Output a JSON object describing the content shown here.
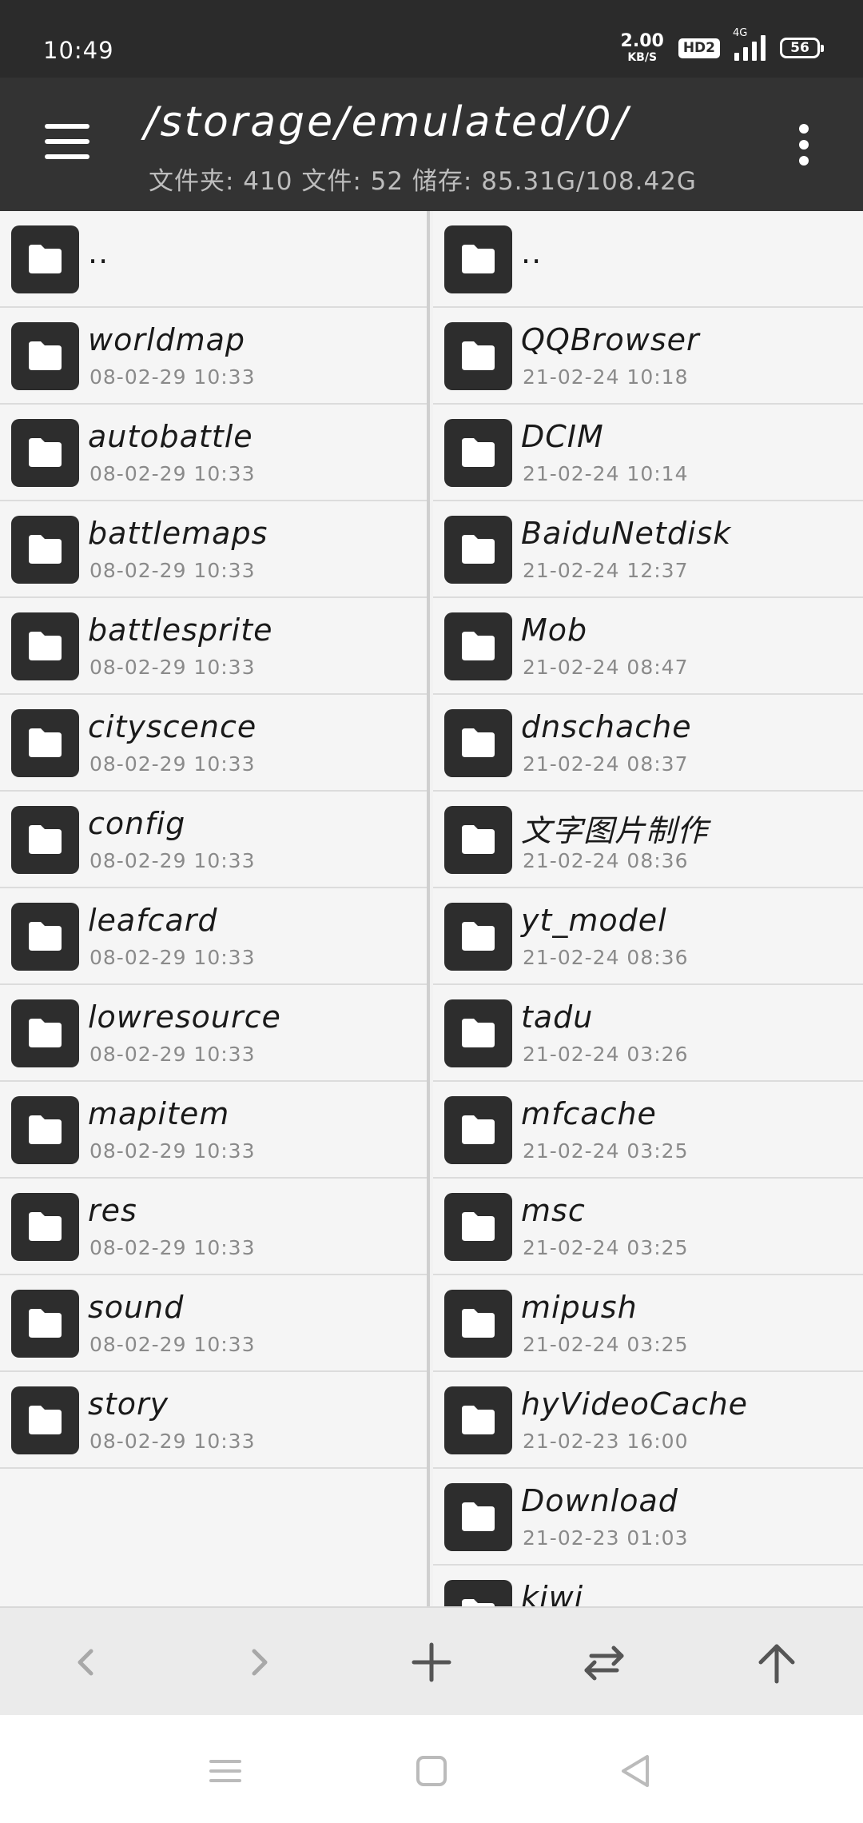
{
  "status_bar": {
    "time": "10:49",
    "net_speed_value": "2.00",
    "net_speed_unit": "KB/S",
    "hd_badge": "HD2",
    "network_type": "4G",
    "battery_level": "56"
  },
  "app_bar": {
    "path": "/storage/emulated/0/",
    "summary": "文件夹: 410  文件: 52  储存: 85.31G/108.42G",
    "menu_icon": "hamburger-menu-icon",
    "more_icon": "vertical-dots-icon"
  },
  "left_pane": {
    "items": [
      {
        "name": "..",
        "date": ""
      },
      {
        "name": "worldmap",
        "date": "08-02-29 10:33"
      },
      {
        "name": "autobattle",
        "date": "08-02-29 10:33"
      },
      {
        "name": "battlemaps",
        "date": "08-02-29 10:33"
      },
      {
        "name": "battlesprite",
        "date": "08-02-29 10:33"
      },
      {
        "name": "cityscence",
        "date": "08-02-29 10:33"
      },
      {
        "name": "config",
        "date": "08-02-29 10:33"
      },
      {
        "name": "leafcard",
        "date": "08-02-29 10:33"
      },
      {
        "name": "lowresource",
        "date": "08-02-29 10:33"
      },
      {
        "name": "mapitem",
        "date": "08-02-29 10:33"
      },
      {
        "name": "res",
        "date": "08-02-29 10:33"
      },
      {
        "name": "sound",
        "date": "08-02-29 10:33"
      },
      {
        "name": "story",
        "date": "08-02-29 10:33"
      }
    ]
  },
  "right_pane": {
    "items": [
      {
        "name": "..",
        "date": ""
      },
      {
        "name": "QQBrowser",
        "date": "21-02-24 10:18"
      },
      {
        "name": "DCIM",
        "date": "21-02-24 10:14"
      },
      {
        "name": "BaiduNetdisk",
        "date": "21-02-24 12:37"
      },
      {
        "name": "Mob",
        "date": "21-02-24 08:47"
      },
      {
        "name": "dnschache",
        "date": "21-02-24 08:37"
      },
      {
        "name": "文字图片制作",
        "date": "21-02-24 08:36"
      },
      {
        "name": "yt_model",
        "date": "21-02-24 08:36"
      },
      {
        "name": "tadu",
        "date": "21-02-24 03:26"
      },
      {
        "name": "mfcache",
        "date": "21-02-24 03:25"
      },
      {
        "name": "msc",
        "date": "21-02-24 03:25"
      },
      {
        "name": "mipush",
        "date": "21-02-24 03:25"
      },
      {
        "name": "hyVideoCache",
        "date": "21-02-23 16:00"
      },
      {
        "name": "Download",
        "date": "21-02-23 01:03"
      },
      {
        "name": "kiwi",
        "date": ""
      }
    ]
  },
  "toolbar": {
    "back_icon": "chevron-left-icon",
    "forward_icon": "chevron-right-icon",
    "add_icon": "plus-icon",
    "swap_icon": "swap-arrows-icon",
    "up_icon": "arrow-up-icon"
  },
  "colors": {
    "status_bar_bg": "#2b2b2b",
    "app_bar_bg": "#333333",
    "folder_icon_bg": "#2d2d2d",
    "pane_bg": "#f5f5f5",
    "toolbar_bg": "#ebebeb"
  }
}
